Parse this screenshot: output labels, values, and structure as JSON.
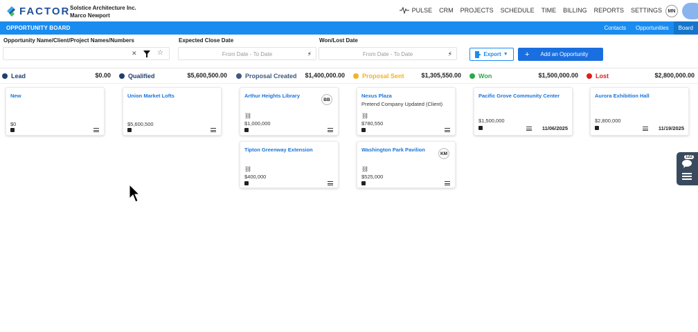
{
  "header": {
    "logo_text": "FACTOR",
    "company_name": "Solstice Architecture Inc.",
    "user_name": "Marco Newport",
    "nav": [
      "PULSE",
      "CRM",
      "PROJECTS",
      "SCHEDULE",
      "TIME",
      "BILLING",
      "REPORTS",
      "SETTINGS"
    ],
    "avatar_initials": "MN"
  },
  "subbar": {
    "title": "OPPORTUNITY BOARD",
    "tabs": [
      "Contacts",
      "Opportunities",
      "Board"
    ],
    "active_tab": "Board"
  },
  "filters": {
    "search_label": "Opportunity Name/Client/Project Names/Numbers",
    "search_placeholder": "",
    "close_date_label": "Expected Close Date",
    "close_date_placeholder": "From Date - To Date",
    "wonlost_label": "Won/Lost Date",
    "wonlost_placeholder": "From Date - To Date",
    "export_label": "Export",
    "add_label": "Add an Opportunity"
  },
  "colors": {
    "accent": "#1a8cf0",
    "lead": "#1f3f6e",
    "qualified": "#1f3f6e",
    "proposal_created": "#3c5a7d",
    "proposal_sent": "#f0b429",
    "won": "#2ca84a",
    "lost": "#d92020"
  },
  "stages": [
    {
      "name": "Lead",
      "amount": "$0.00",
      "color": "#1f3f6e",
      "text_color": "#1f3f6e"
    },
    {
      "name": "Qualified",
      "amount": "$5,600,500.00",
      "color": "#1f3f6e",
      "text_color": "#1f3f6e"
    },
    {
      "name": "Proposal Created",
      "amount": "$1,400,000.00",
      "color": "#3c5a7d",
      "text_color": "#3c5a7d"
    },
    {
      "name": "Proposal Sent",
      "amount": "$1,305,550.00",
      "color": "#f0b429",
      "text_color": "#f0b429"
    },
    {
      "name": "Won",
      "amount": "$1,500,000.00",
      "color": "#2ca84a",
      "text_color": "#2ca84a"
    },
    {
      "name": "Lost",
      "amount": "$2,800,000.00",
      "color": "#d92020",
      "text_color": "#d92020"
    }
  ],
  "cards": {
    "new": {
      "title": "New",
      "amount": "$0"
    },
    "union": {
      "title": "Union Market Lofts",
      "amount": "$5,600,500"
    },
    "arthur": {
      "title": "Arthur Heights Library",
      "amount": "$1,000,000",
      "initials": "BB"
    },
    "tipton": {
      "title": "Tipton Greenway Extension",
      "amount": "$400,000"
    },
    "nexus": {
      "title": "Nexus Plaza",
      "subtitle": "Pretend Company Updated (Client)",
      "amount": "$780,550"
    },
    "washington": {
      "title": "Washington Park Pavilion",
      "amount": "$525,000",
      "initials": "KM"
    },
    "pacific": {
      "title": "Pacific Grove Community Center",
      "amount": "$1,500,000",
      "date": "11/06/2025"
    },
    "aurora": {
      "title": "Aurora Exhibition Hall",
      "amount": "$2,800,000",
      "date": "11/19/2025"
    }
  },
  "side_widget": {
    "badge": "122"
  }
}
